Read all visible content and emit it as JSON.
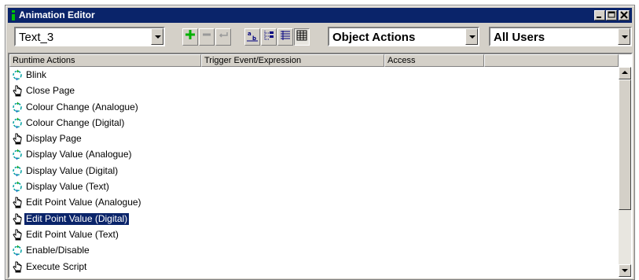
{
  "window": {
    "title": "Animation Editor",
    "buttons": [
      "minimize",
      "maximize",
      "close"
    ]
  },
  "toolbar": {
    "object_select": "Text_3",
    "action_filter": "Object Actions",
    "user_filter": "All Users",
    "buttons": [
      {
        "name": "add-action-button",
        "icon": "plus-icon"
      },
      {
        "name": "remove-action-button",
        "icon": "minus-icon"
      },
      {
        "name": "back-button",
        "icon": "arrow-left-icon"
      },
      {
        "name": "sort-button",
        "icon": "sort-icon"
      },
      {
        "name": "tree-view-button",
        "icon": "tree-view-icon"
      },
      {
        "name": "list-view-button",
        "icon": "list-view-icon"
      },
      {
        "name": "details-view-button",
        "icon": "grid-view-icon"
      }
    ]
  },
  "list": {
    "columns": [
      "Runtime Actions",
      "Trigger Event/Expression",
      "Access",
      ""
    ],
    "rows": [
      {
        "label": "Blink",
        "icon": "animation-icon"
      },
      {
        "label": "Close Page",
        "icon": "hand-icon"
      },
      {
        "label": "Colour Change (Analogue)",
        "icon": "animation-icon"
      },
      {
        "label": "Colour Change (Digital)",
        "icon": "animation-icon"
      },
      {
        "label": "Display Page",
        "icon": "hand-icon"
      },
      {
        "label": "Display Value (Analogue)",
        "icon": "animation-icon"
      },
      {
        "label": "Display Value (Digital)",
        "icon": "animation-icon"
      },
      {
        "label": "Display Value (Text)",
        "icon": "animation-icon"
      },
      {
        "label": "Edit Point Value (Analogue)",
        "icon": "hand-icon"
      },
      {
        "label": "Edit Point Value (Digital)",
        "icon": "hand-icon",
        "selected": true
      },
      {
        "label": "Edit Point Value (Text)",
        "icon": "hand-icon"
      },
      {
        "label": "Enable/Disable",
        "icon": "animation-icon"
      },
      {
        "label": "Execute Script",
        "icon": "hand-icon"
      }
    ]
  },
  "colors": {
    "title_bar": "#0a246a",
    "face": "#d4d0c8",
    "selection": "#0a246a"
  }
}
